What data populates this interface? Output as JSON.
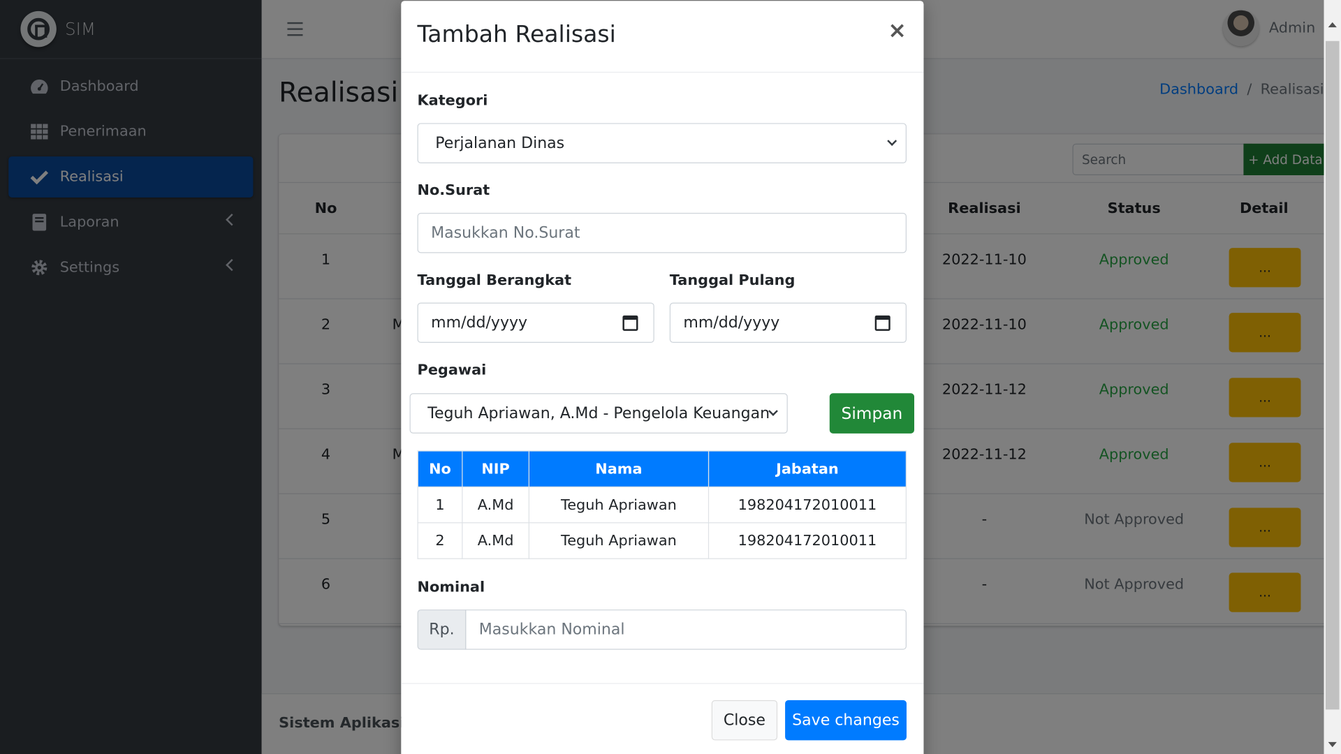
{
  "brand": {
    "name": "SIM"
  },
  "sidebar": {
    "items": [
      {
        "label": "Dashboard",
        "icon": "tachometer-icon"
      },
      {
        "label": "Penerimaan",
        "icon": "grid-icon"
      },
      {
        "label": "Realisasi",
        "icon": "check-icon",
        "active": true
      },
      {
        "label": "Laporan",
        "icon": "book-icon"
      },
      {
        "label": "Settings",
        "icon": "gear-icon"
      }
    ]
  },
  "header": {
    "user": "Admin"
  },
  "page": {
    "title": "Realisasi",
    "breadcrumb": [
      "Dashboard",
      "/",
      "Realisasi"
    ],
    "search_placeholder": "Search",
    "add_button": "+ Add Data",
    "footer": "Sistem Aplikasi M"
  },
  "bg_table": {
    "headers": [
      "No",
      "Realisasi",
      "Status",
      "Detail"
    ],
    "rows": [
      {
        "no": "1",
        "extra": "",
        "realisasi": "2022-11-10",
        "status": "Approved",
        "detail": "..."
      },
      {
        "no": "2",
        "extra": "M",
        "realisasi": "2022-11-10",
        "status": "Approved",
        "detail": "..."
      },
      {
        "no": "3",
        "extra": "",
        "realisasi": "2022-11-12",
        "status": "Approved",
        "detail": "..."
      },
      {
        "no": "4",
        "extra": "M",
        "realisasi": "2022-11-12",
        "status": "Approved",
        "detail": "..."
      },
      {
        "no": "5",
        "extra": "",
        "realisasi": "-",
        "status": "Not Approved",
        "detail": "..."
      },
      {
        "no": "6",
        "extra": "",
        "realisasi": "-",
        "status": "Not Approved",
        "detail": "..."
      }
    ]
  },
  "colors": {
    "approved": "#28a745",
    "not_approved": "#6c757d",
    "accent": "#007bff"
  },
  "modal": {
    "title": "Tambah Realisasi",
    "close_symbol": "×",
    "kategori_label": "Kategori",
    "kategori_value": "Perjalanan Dinas",
    "surat_label": "No.Surat",
    "surat_placeholder": "Masukkan No.Surat",
    "berangkat_label": "Tanggal Berangkat",
    "berangkat_placeholder": "mm/dd/yyyy",
    "pulang_label": "Tanggal Pulang",
    "pulang_placeholder": "mm/dd/yyyy",
    "pegawai_label": "Pegawai",
    "pegawai_value": "Teguh Apriawan, A.Md - Pengelola Keuangan",
    "simpan_button": "Simpan",
    "table_headers": [
      "No",
      "NIP",
      "Nama",
      "Jabatan"
    ],
    "table_rows": [
      [
        "1",
        "A.Md",
        "Teguh Apriawan",
        "198204172010011"
      ],
      [
        "2",
        "A.Md",
        "Teguh Apriawan",
        "198204172010011"
      ]
    ],
    "nominal_label": "Nominal",
    "nominal_prefix": "Rp.",
    "nominal_placeholder": "Masukkan Nominal",
    "close_button": "Close",
    "save_button": "Save changes"
  }
}
